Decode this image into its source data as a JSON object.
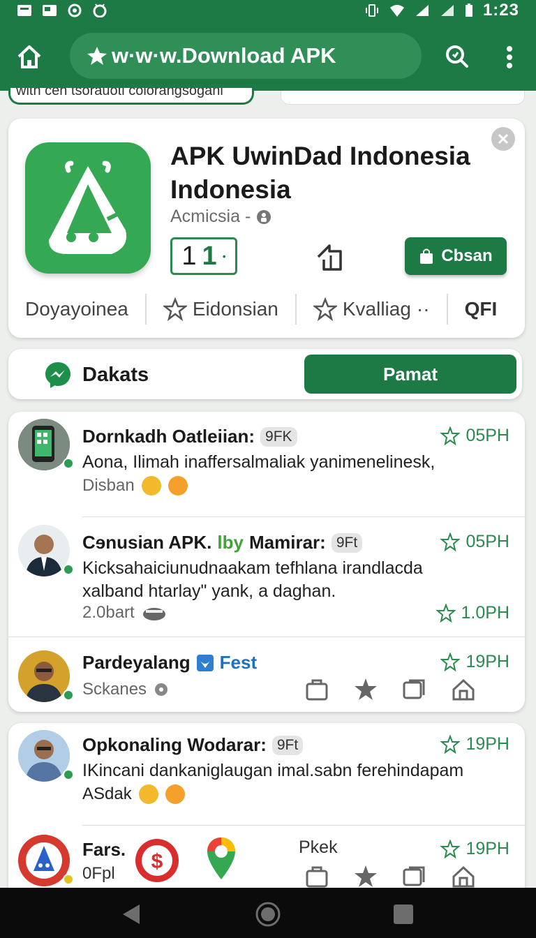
{
  "status_bar": {
    "time": "1:23"
  },
  "app_bar": {
    "url": "w·w·w.Download APK"
  },
  "partial_strip": {
    "chip_text": "with ceh tsorauoti colorangsogani"
  },
  "app": {
    "title": "APK UwinDad Indonesia Indonesia",
    "developer": "Acmicsia -",
    "rating_digit_1": "1",
    "rating_digit_2": "1",
    "install_label": "Cbsan",
    "meta": [
      "Doyayoinea",
      "Eidonsian",
      "Kvalliag",
      "QFI"
    ],
    "meta_more": "··"
  },
  "tabs": {
    "left_label": "Dakats",
    "right_label": "Pamat"
  },
  "reviews": [
    {
      "name": "Dornkadh Oatleiian:",
      "badge": "9FK",
      "time": "05PH",
      "text": "Aona, Ilimah inaffersalmaliak yanimenelinesk,",
      "sub": "Disban"
    },
    {
      "name": "Cɘnusian APK.",
      "name_highlight": "lby",
      "name_rest": "Mamirar:",
      "badge": "9Ft",
      "time": "05PH",
      "text": "Kicksahaiciunudnaakam tefhlana irandlacda xalband htarlay\" yank, a daghan.",
      "sub": "2.0bart",
      "time2": "1.0PH"
    },
    {
      "name": "Pardeyalang",
      "tag": "Fest",
      "time": "19PH",
      "sub": "Sckanes"
    },
    {
      "name": "Opkonaling Wodarar:",
      "badge": "9Ft",
      "time": "19PH",
      "text": "IKincani  dankaniglaugan imal.sabn ferehindapam",
      "sub": "ASdak"
    },
    {
      "name": "Fars.",
      "sub": "0Fрl",
      "mid_label": "Pkek",
      "time": "19PH"
    }
  ],
  "colors": {
    "brand_green": "#1d7a45",
    "accent_green": "#34a853",
    "time_green": "#2a8b50"
  }
}
